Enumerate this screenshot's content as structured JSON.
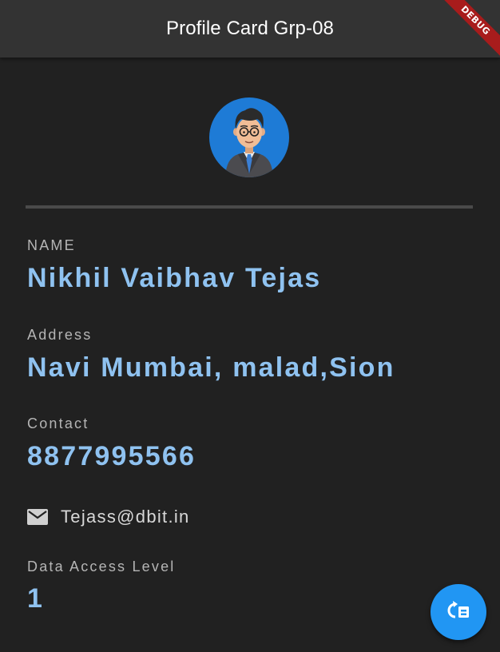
{
  "appbar": {
    "title": "Profile Card Grp-08",
    "debug_label": "DEBUG"
  },
  "avatar": {
    "icon": "person-avatar-icon",
    "background_color": "#1e7bd6"
  },
  "profile": {
    "name_label": "NAME",
    "name_value": "Nikhil Vaibhav Tejas",
    "address_label": "Address",
    "address_value": "Navi Mumbai, malad,Sion",
    "contact_label": "Contact",
    "contact_value": "8877995566",
    "email_icon": "mail-icon",
    "email_value": "Tejass@dbit.in",
    "access_label": "Data Access Level",
    "access_value": "1"
  },
  "fab": {
    "icon": "switch-access-icon",
    "color": "#2196f3"
  },
  "colors": {
    "background": "#212121",
    "appbar": "#333333",
    "value_text": "#8fc2f0",
    "label_text": "#b5b5b5",
    "debug_ribbon": "#a81c1c"
  }
}
